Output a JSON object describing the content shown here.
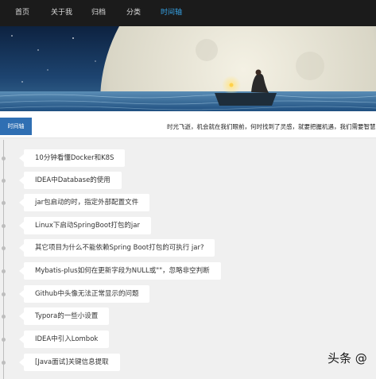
{
  "nav": {
    "items": [
      {
        "label": "首页"
      },
      {
        "label": "关于我"
      },
      {
        "label": "归档"
      },
      {
        "label": "分类"
      },
      {
        "label": "时间轴",
        "active": true
      }
    ]
  },
  "subbar": {
    "tab_label": "时间轴",
    "motto": "时光飞逝，机会就在我们眼前，何时找到了灵感，就要把握机遇，我们需要智慧"
  },
  "timeline": {
    "posts": [
      {
        "title": "10分钟看懂Docker和K8S"
      },
      {
        "title": "IDEA中Database的使用"
      },
      {
        "title": "jar包启动的时，指定外部配置文件"
      },
      {
        "title": "Linux下启动SpringBoot打包的jar"
      },
      {
        "title": "其它项目为什么不能依赖Spring Boot打包的可执行 jar?"
      },
      {
        "title": "Mybatis-plus如何在更新字段为NULL或\"\"，忽略非空判断"
      },
      {
        "title": "Github中头像无法正常显示的问题"
      },
      {
        "title": "Typora的一些小设置"
      },
      {
        "title": "IDEA中引入Lombok"
      },
      {
        "title": "[Java面试]关键信息提取"
      }
    ]
  },
  "watermark": "头条 @",
  "colors": {
    "nav_bg": "#1b1b1b",
    "nav_active": "#37a3e6",
    "tab_bg": "#2f6fb3",
    "page_bg": "#f0f0f0"
  }
}
